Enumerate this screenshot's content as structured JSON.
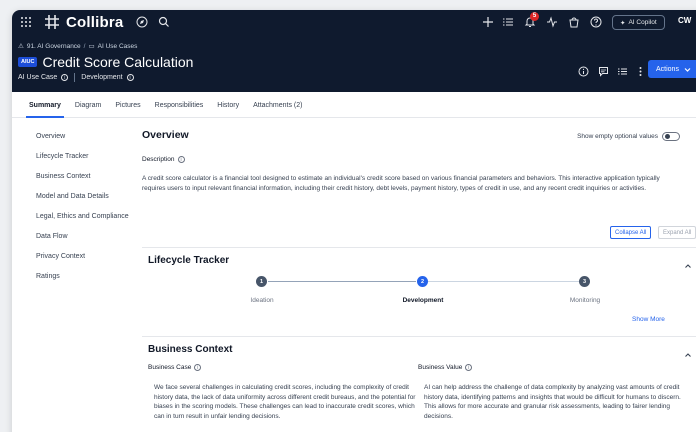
{
  "app": {
    "brand": "Collibra",
    "notification_count": "5",
    "copilot_label": "AI Copilot",
    "user_initials": "CW"
  },
  "breadcrumb": {
    "domain": "91. AI Governance",
    "separator": "/",
    "community": "AI Use Cases"
  },
  "asset": {
    "type_badge": "AIUC",
    "title": "Credit Score Calculation",
    "asset_type": "AI Use Case",
    "status": "Development",
    "actions_label": "Actions"
  },
  "tabs": [
    {
      "label": "Summary",
      "active": true
    },
    {
      "label": "Diagram"
    },
    {
      "label": "Pictures"
    },
    {
      "label": "Responsibilities"
    },
    {
      "label": "History"
    },
    {
      "label": "Attachments (2)"
    }
  ],
  "sidebar": {
    "items": [
      {
        "label": "Overview"
      },
      {
        "label": "Lifecycle Tracker"
      },
      {
        "label": "Business Context"
      },
      {
        "label": "Model and Data Details"
      },
      {
        "label": "Legal, Ethics and Compliance"
      },
      {
        "label": "Data Flow"
      },
      {
        "label": "Privacy Context"
      },
      {
        "label": "Ratings"
      }
    ]
  },
  "overview": {
    "title": "Overview",
    "show_empty_label": "Show empty optional values",
    "description_label": "Description",
    "description_text": "A credit score calculator is a financial tool designed to estimate an individual's credit score based on various financial parameters and behaviors. This interactive application typically requires users to input relevant financial information, including their credit history, debt levels, payment history, types of credit in use, and any recent credit inquiries or activities.",
    "collapse_all": "Collapse All",
    "expand_all": "Expand All"
  },
  "lifecycle": {
    "title": "Lifecycle Tracker",
    "steps": [
      {
        "num": "1",
        "label": "Ideation"
      },
      {
        "num": "2",
        "label": "Development"
      },
      {
        "num": "3",
        "label": "Monitoring"
      }
    ],
    "show_more": "Show More"
  },
  "business_context": {
    "title": "Business Context",
    "case_label": "Business Case",
    "case_text": "We face several challenges in calculating credit scores, including the complexity of credit history data, the lack of data uniformity across different credit bureaus, and the potential for biases in the scoring models. These challenges can lead to inaccurate credit scores, which can in turn result in unfair lending decisions.",
    "value_label": "Business Value",
    "value_text": "AI can help address the challenge of data complexity by analyzing vast amounts of credit history data, identifying patterns and insights that would be difficult for humans to discern. This allows for more accurate and granular risk assessments, leading to fairer lending decisions."
  },
  "colors": {
    "header_bg": "#0f1a2e",
    "accent": "#2563eb",
    "badge_red": "#dc2626"
  }
}
